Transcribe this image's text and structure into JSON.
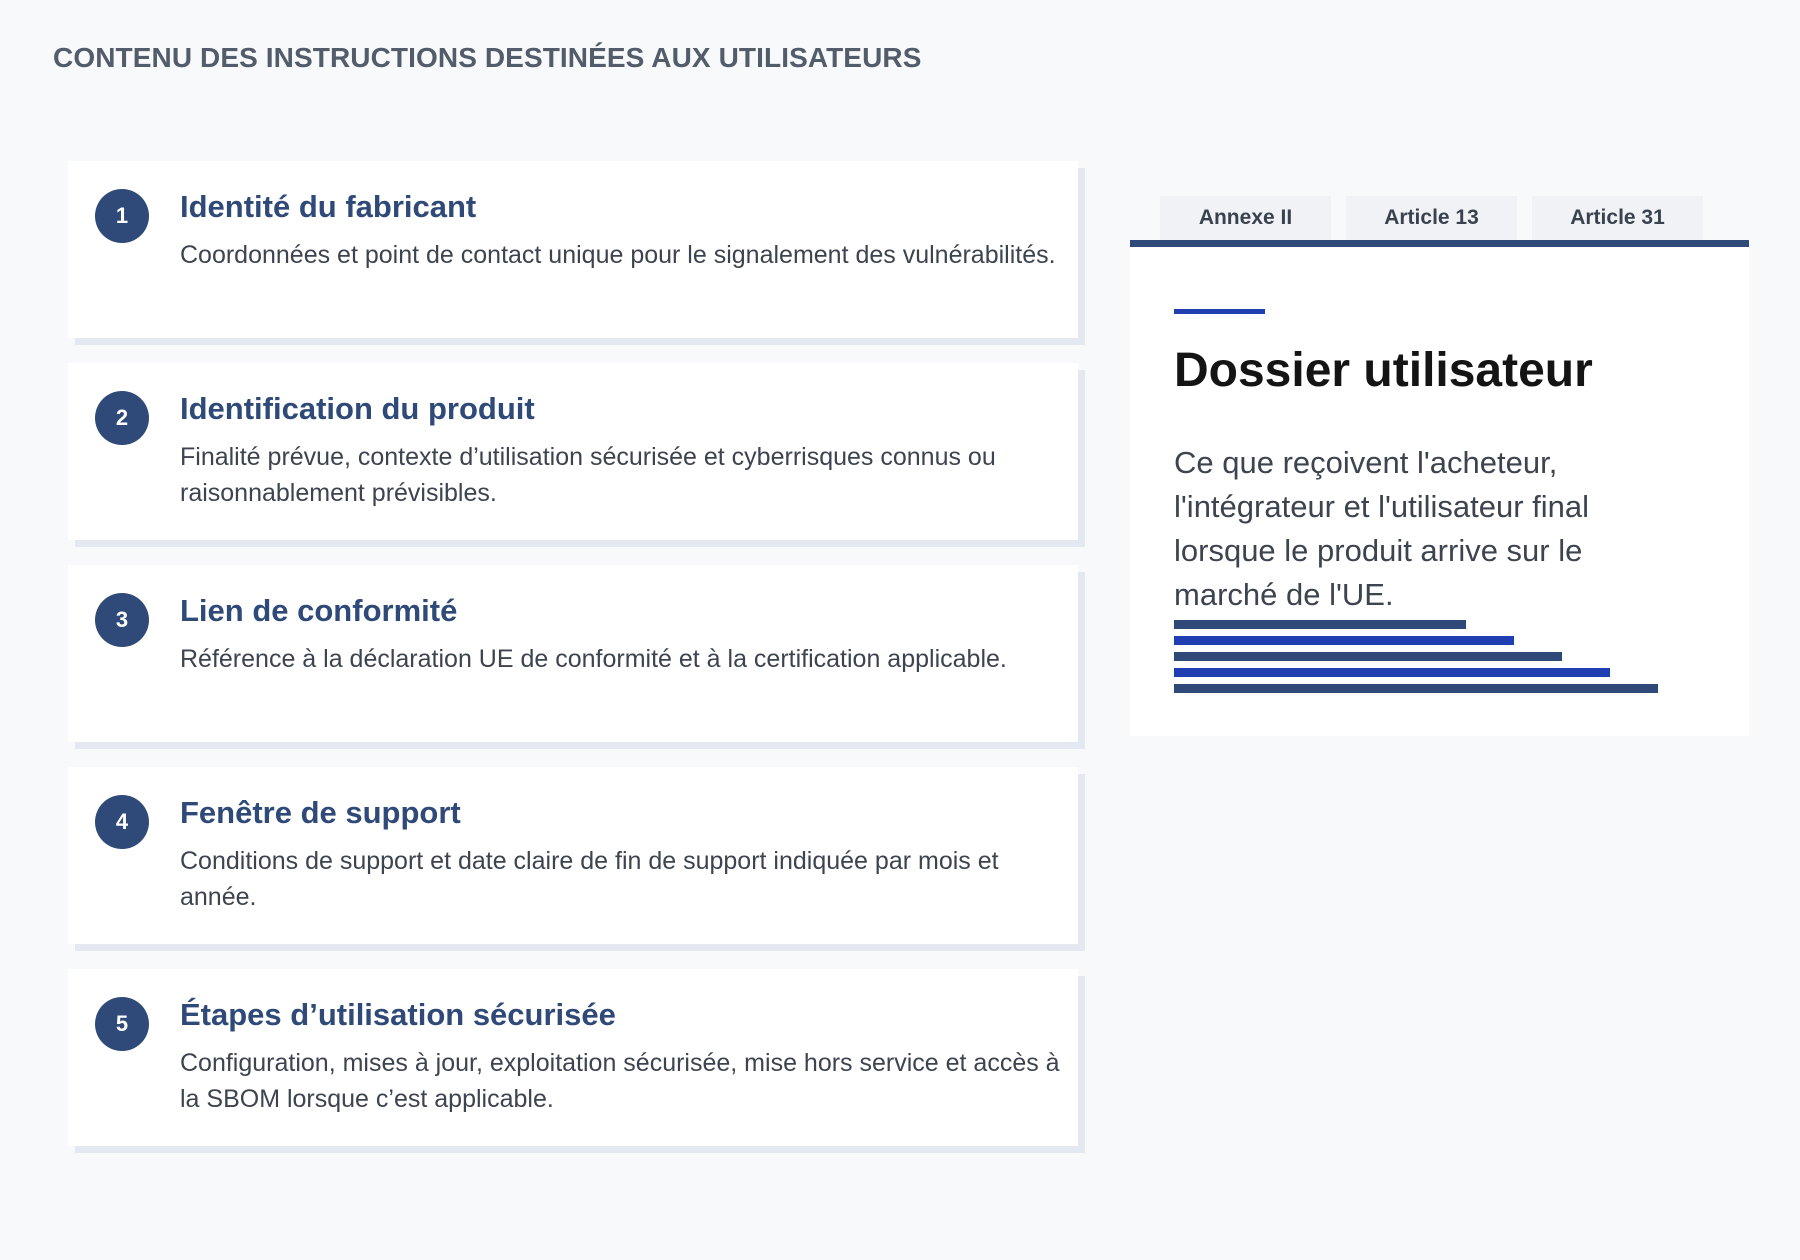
{
  "header": {
    "title": "CONTENU DES INSTRUCTIONS DESTINÉES AUX UTILISATEURS"
  },
  "items": [
    {
      "num": "1",
      "title": "Identité du fabricant",
      "desc": "Coordonnées et point de contact unique pour le signalement des vulnérabilités."
    },
    {
      "num": "2",
      "title": "Identification du produit",
      "desc": "Finalité prévue, contexte d’utilisation sécurisée et cyberrisques connus ou raisonnablement prévisibles."
    },
    {
      "num": "3",
      "title": "Lien de conformité",
      "desc": "Référence à la déclaration UE de conformité et à la certification applicable."
    },
    {
      "num": "4",
      "title": "Fenêtre de support",
      "desc": "Conditions de support et date claire de fin de support indiquée par mois et année."
    },
    {
      "num": "5",
      "title": "Étapes d’utilisation sécurisée",
      "desc": "Configuration, mises à jour, exploitation sécurisée, mise hors service et accès à la SBOM lorsque c’est applicable."
    }
  ],
  "panel": {
    "tabs": [
      {
        "label": "Annexe II"
      },
      {
        "label": "Article 13"
      },
      {
        "label": "Article 31"
      }
    ],
    "heading": "Dossier utilisateur",
    "text": "Ce que reçoivent l'acheteur, l'intégrateur et l'utilisateur final lorsque le produit arrive sur le marché de l'UE.",
    "colors": {
      "navy": "#2f4a78",
      "blue": "#1f3fb0"
    }
  }
}
